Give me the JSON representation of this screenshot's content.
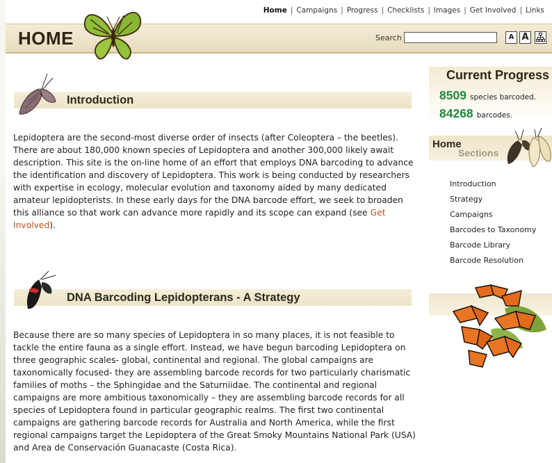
{
  "nav": {
    "items": [
      {
        "label": "Home",
        "active": true
      },
      {
        "label": "Campaigns",
        "active": false
      },
      {
        "label": "Progress",
        "active": false
      },
      {
        "label": "Checklists",
        "active": false
      },
      {
        "label": "Images",
        "active": false
      },
      {
        "label": "Get Involved",
        "active": false
      },
      {
        "label": "Links",
        "active": false
      }
    ]
  },
  "header": {
    "title": "HOME",
    "search_label": "Search",
    "search_value": "",
    "font_small": "A",
    "font_large": "A"
  },
  "sections": {
    "intro": {
      "heading": "Introduction",
      "text_before_link": "Lepidoptera are the second-most diverse order of insects (after Coleoptera – the beetles). There are about 180,000 known species of Lepidoptera and another 300,000 likely await description. This site is the on-line home of an effort that employs DNA barcoding to advance the identification and discovery of Lepidoptera. This work is being conducted by researchers with expertise in ecology, molecular evolution and taxonomy aided by many dedicated amateur lepidopterists. In these early days for the DNA barcode effort, we seek to broaden this alliance so that work can advance more rapidly and its scope can expand (see ",
      "link": "Get Involved",
      "text_after_link": ")."
    },
    "strategy": {
      "heading": "DNA Barcoding Lepidopterans - A Strategy",
      "text": "Because there are so many species of Lepidoptera in so many places, it is not feasible to tackle the entire fauna as a single effort. Instead, we have begun barcoding Lepidoptera on three geographic scales- global, continental and regional. The global campaigns are taxonomically focused- they are assembling barcode records for two particularly charismatic families of moths – the Sphingidae and the Saturniidae. The continental and regional campaigns are more ambitious taxonomically – they are assembling barcode records for all species of Lepidoptera found in particular geographic realms. The first two continental campaigns are gathering barcode records for Australia and North America, while the first regional campaigns target the Lepidoptera of the Great Smoky Mountains National Park (USA) and Area de Conservación Guanacaste (Costa Rica)."
    }
  },
  "progress": {
    "title": "Current Progress",
    "species_count": "8509",
    "species_label": "species barcoded.",
    "barcode_count": "84268",
    "barcode_label": "barcodes."
  },
  "home_sections": {
    "home": "Home",
    "sections": "Sections",
    "items": [
      "Introduction",
      "Strategy",
      "Campaigns",
      "Barcodes to Taxonomy",
      "Barcode Library",
      "Barcode Resolution"
    ]
  },
  "colors": {
    "accent_green": "#1d8a3d",
    "link_orange": "#c3501c",
    "band_tan": "#ece2c6"
  }
}
